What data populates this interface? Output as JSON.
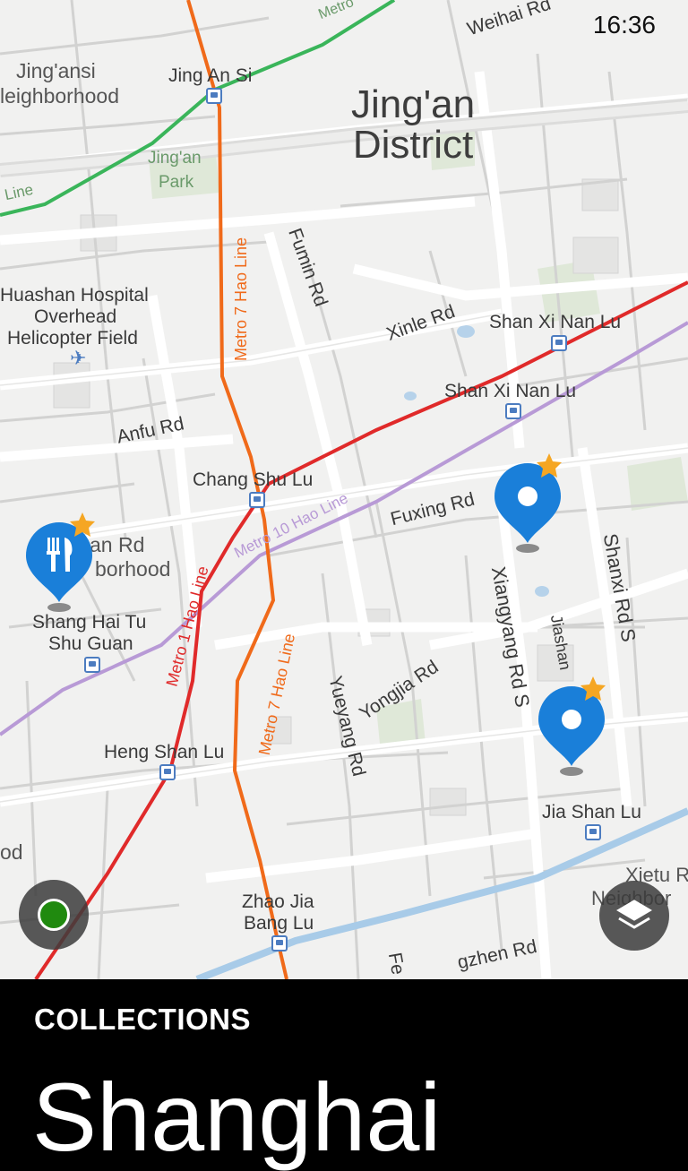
{
  "status": {
    "time": "16:36"
  },
  "map": {
    "district": {
      "line1": "Jing'an",
      "line2": "District"
    },
    "labels": {
      "weihai_rd": "Weihai  Rd",
      "metro_top": "Metro",
      "jingansi_station": "Jing An Si",
      "jingansi_nb_1": "Jing'ansi",
      "jingansi_nb_2": "leighborhood",
      "jingan_park_1": "Jing'an",
      "jingan_park_2": "Park",
      "line_left": "Line",
      "fumin_rd": "Fumin Rd",
      "metro7_top": "Metro  7  Hao  Line",
      "huashan_1": "Huashan Hospital",
      "huashan_2": "Overhead",
      "huashan_3": "Helicopter Field",
      "xinle_rd": "Xinle  Rd",
      "shanxinanlu_1": "Shan Xi Nan Lu",
      "shanxinanlu_2": "Shan Xi Nan Lu",
      "anfu_rd": "Anfu  Rd",
      "changshulu": "Chang Shu Lu",
      "metro10": "Metro  10  Hao  Line",
      "fuxing_rd": "Fuxing  Rd",
      "an_rd": "an Rd",
      "borhood": "borhood",
      "shanghaitu_1": "Shang Hai Tu",
      "shanghaitu_2": "Shu Guan",
      "metro1": "Metro  1  Hao  Line",
      "metro7_bottom": "Metro  7  Hao  Line",
      "xiangyang": "Xiangyang Rd S",
      "shanxi_rd": "Shanxi Rd S",
      "jiashan": "Jiashan",
      "yongjia": "Yongjia  Rd",
      "yueyang": "Yueyang Rd",
      "hengshanlu": "Heng Shan Lu",
      "jiashanlu": "Jia Shan Lu",
      "od": "od",
      "xietu_1": "Xietu R",
      "xietu_2": "Neighbor",
      "zhaojia_1": "Zhao Jia",
      "zhaojia_2": "Bang Lu",
      "fe": "Fe",
      "zhen_rd": "gzhen  Rd"
    },
    "pins": [
      {
        "name": "restaurant-pin",
        "icon": "fork-knife-icon",
        "starred": true
      },
      {
        "name": "place-pin-1",
        "icon": "dot-icon",
        "starred": true
      },
      {
        "name": "place-pin-2",
        "icon": "dot-icon",
        "starred": true
      }
    ],
    "colors": {
      "pin": "#1a7fd9",
      "star": "#f5a623",
      "metro1": "#e02a2a",
      "metro7": "#f06a1a",
      "metro10": "#b89ad6",
      "metro2": "#3ab55a",
      "location": "#208a0f"
    }
  },
  "controls": {
    "location_icon": "location-dot-icon",
    "layers_icon": "layers-icon"
  },
  "panel": {
    "title": "COLLECTIONS",
    "city": "Shanghai"
  }
}
